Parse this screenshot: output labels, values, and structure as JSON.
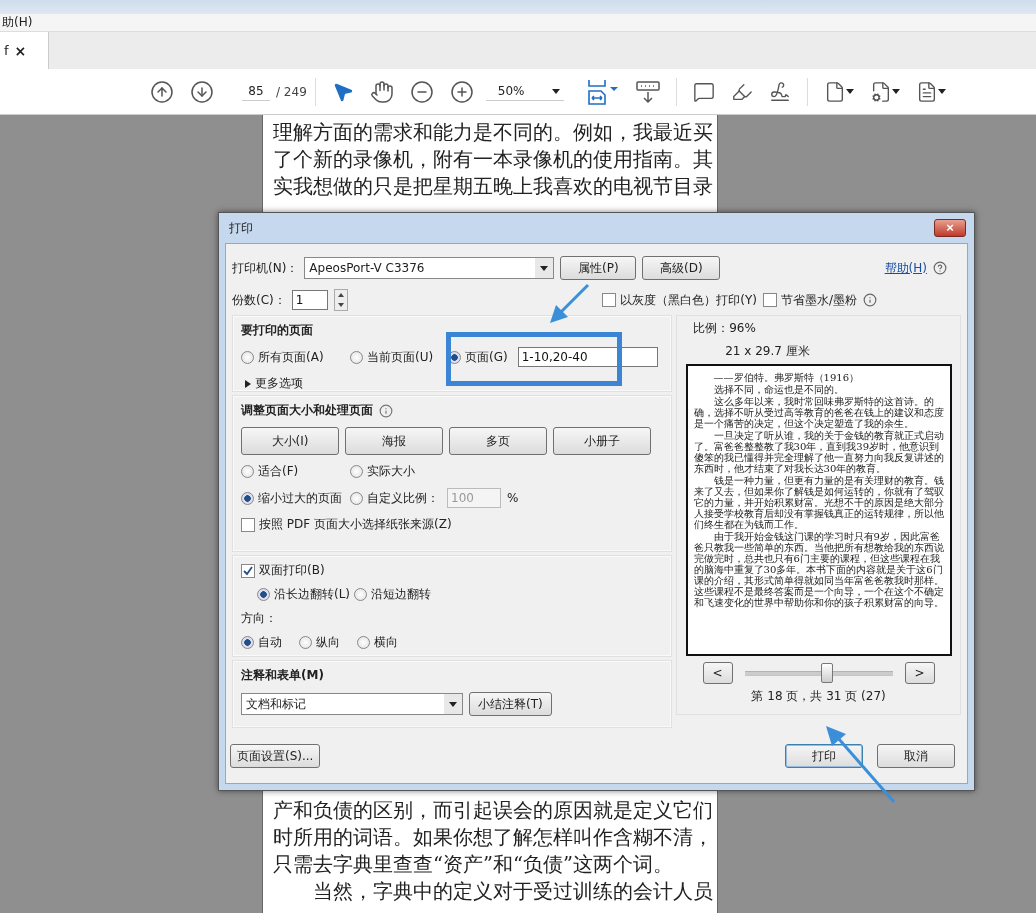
{
  "menu": {
    "label": "助(H)"
  },
  "tab": {
    "label": "f",
    "close": "×"
  },
  "toolbar": {
    "page_current": "85",
    "page_total": "/ 249",
    "zoom": "50%"
  },
  "document": {
    "lines_above": [
      {
        "kind": "line",
        "text": "理解方面的需求和能力是不同的。例如，我最近买"
      },
      {
        "kind": "line",
        "text": "了个新的录像机，附有一本录像机的使用指南。其"
      },
      {
        "kind": "line",
        "text": "实我想做的只是把星期五晚上我喜欢的电视节目录"
      }
    ],
    "lines_below": [
      {
        "kind": "line",
        "text": "产和负债的区别，而引起误会的原因就是定义它们"
      },
      {
        "kind": "line",
        "text": "时所用的词语。如果你想了解怎样叫作含糊不清，"
      },
      {
        "kind": "line",
        "text": "只需去字典里查查“资产”和“负债”这两个词。"
      },
      {
        "kind": "paragraph",
        "text": "当然，字典中的定义对于受过训练的会计人员"
      }
    ]
  },
  "dialog": {
    "title": "打印",
    "close": "×",
    "printer": {
      "label": "打印机(N)：",
      "value": "ApeosPort-V C3376",
      "buttons": [
        "属性(P)",
        "高级(D)"
      ],
      "help": "帮助(H)"
    },
    "copies": {
      "label": "份数(C)：",
      "value": "1"
    },
    "options": [
      {
        "label": "以灰度（黑白色）打印(Y)",
        "checked": false
      },
      {
        "label": "节省墨水/墨粉",
        "checked": false
      }
    ],
    "pages": {
      "title": "要打印的页面",
      "choices": [
        {
          "label": "所有页面(A)",
          "selected": false
        },
        {
          "label": "当前页面(U)",
          "selected": false
        },
        {
          "label": "页面(G)",
          "selected": true
        }
      ],
      "range": "1-10,20-40",
      "more": "更多选项"
    },
    "sizing": {
      "title": "调整页面大小和处理页面",
      "modes": [
        "大小(I)",
        "海报",
        "多页",
        "小册子"
      ],
      "scales": [
        {
          "label": "适合(F)",
          "selected": false
        },
        {
          "label": "实际大小",
          "selected": false
        },
        {
          "label": "缩小过大的页面",
          "selected": true
        },
        {
          "label": "自定义比例：",
          "selected": false
        }
      ],
      "custom": {
        "value": "100",
        "unit": "%",
        "disabled": true
      },
      "paper_source": {
        "label": "按照 PDF 页面大小选择纸张来源(Z)",
        "checked": false
      }
    },
    "duplex": {
      "label": "双面打印(B)",
      "checked": true,
      "flips": [
        {
          "label": "沿长边翻转(L)",
          "selected": true
        },
        {
          "label": "沿短边翻转",
          "selected": false
        }
      ],
      "orientation_label": "方向：",
      "orientations": [
        {
          "label": "自动",
          "selected": true
        },
        {
          "label": "纵向",
          "selected": false
        },
        {
          "label": "横向",
          "selected": false
        }
      ]
    },
    "comments": {
      "title": "注释和表单(M)",
      "value": "文档和标记",
      "button": "小结注释(T)"
    },
    "preview": {
      "scale": "比例：96%",
      "size": "21 x 29.7 厘米",
      "paragraphs": [
        {
          "kind": "plain",
          "text": "——罗伯特。弗罗斯特（1916）"
        },
        {
          "kind": "plain",
          "text": "选择不同，命运也是不同的。"
        },
        {
          "kind": "indent",
          "text": "这么多年以来，我时常回味弗罗斯特的这首诗。的确，选择不听从受过高等教育的爸爸在钱上的建议和态度是一个痛苦的决定，但这个决定塑造了我的余生。"
        },
        {
          "kind": "indent",
          "text": "一旦决定了听从谁，我的关于金钱的教育就正式启动了。富爸爸整整教了我30年，直到我39岁时，他意识到傻笨的我已懂得并完全理解了他一直努力向我反复讲述的东西时，他才结束了对我长达30年的教育。"
        },
        {
          "kind": "indent",
          "text": "钱是一种力量，但更有力量的是有关理财的教育。钱来了又去，但如果你了解钱是如何运转的，你就有了驾驭它的力量，并开始积累财富。光想不干的原因是绝大部分人接受学校教育后却没有掌握钱真正的运转规律，所以他们终生都在为钱而工作。"
        },
        {
          "kind": "indent",
          "text": "由于我开始金钱这门课的学习时只有9岁，因此富爸爸只教我一些简单的东西。当他把所有想教给我的东西说完做完时，总共也只有6门主要的课程，但这些课程在我的脑海中重复了30多年。本书下面的内容就是关于这6门课的介绍，其形式简单得就如同当年富爸爸教我时那样。这些课程不是最终答案而是一个向导，一个在这个不确定和飞速变化的世界中帮助你和你的孩子积累财富的向导。"
        }
      ],
      "prev": "<",
      "next": ">",
      "level": 0.56,
      "page_info": "第 18 页，共 31 页 (27)"
    },
    "footer": {
      "setup": "页面设置(S)...",
      "actions": [
        {
          "label": "打印",
          "default": true
        },
        {
          "label": "取消",
          "default": false
        }
      ]
    }
  }
}
